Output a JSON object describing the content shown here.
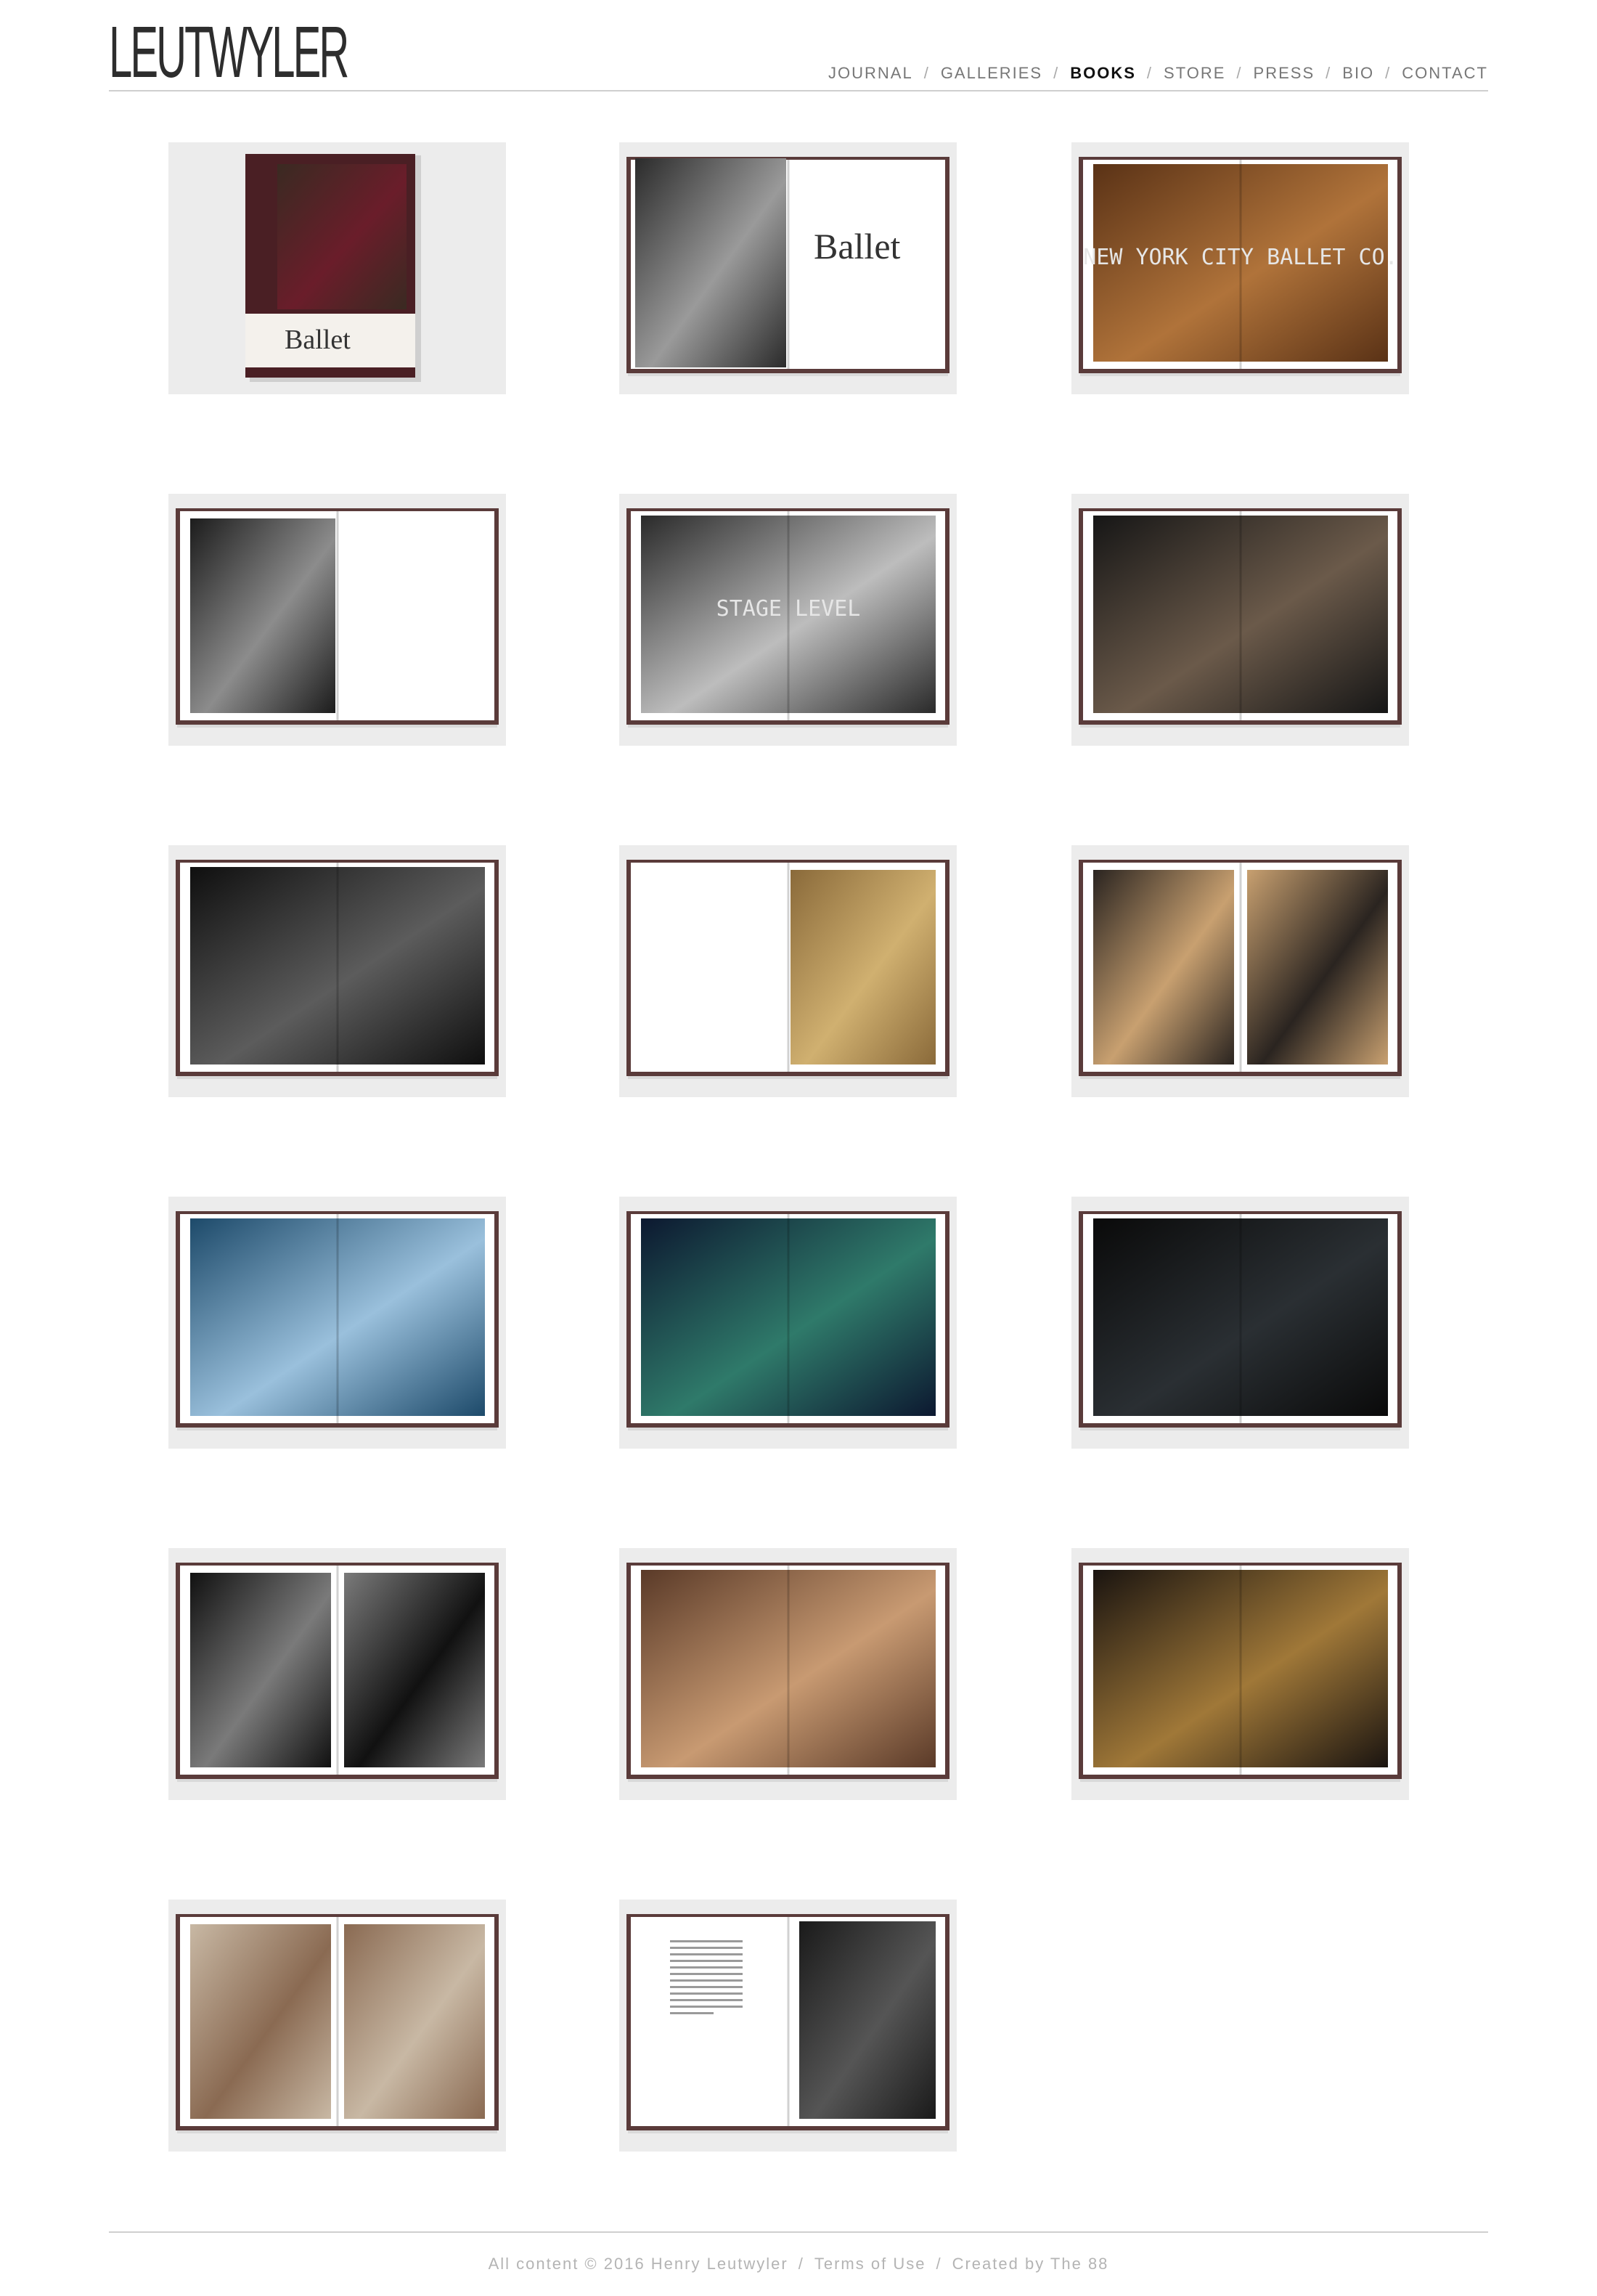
{
  "site": {
    "logo": "LEUTWYLER"
  },
  "nav": [
    {
      "label": "JOURNAL",
      "active": false
    },
    {
      "label": "GALLERIES",
      "active": false
    },
    {
      "label": "BOOKS",
      "active": true
    },
    {
      "label": "STORE",
      "active": false
    },
    {
      "label": "PRESS",
      "active": false
    },
    {
      "label": "BIO",
      "active": false
    },
    {
      "label": "CONTACT",
      "active": false
    }
  ],
  "nav_separator": "/",
  "gallery": {
    "items": [
      {
        "kind": "cover",
        "cover_title": "Ballet"
      },
      {
        "kind": "title-spread",
        "title": "Ballet"
      },
      {
        "kind": "full-spread",
        "text": "NEW YORK CITY BALLET CO."
      },
      {
        "kind": "left-photo-blank"
      },
      {
        "kind": "full-spread",
        "text": "STAGE LEVEL"
      },
      {
        "kind": "full-spread"
      },
      {
        "kind": "full-spread"
      },
      {
        "kind": "right-photo-blank"
      },
      {
        "kind": "two-photos"
      },
      {
        "kind": "full-spread"
      },
      {
        "kind": "full-spread"
      },
      {
        "kind": "full-spread"
      },
      {
        "kind": "two-photos"
      },
      {
        "kind": "full-spread"
      },
      {
        "kind": "full-spread"
      },
      {
        "kind": "two-photos"
      },
      {
        "kind": "text-photo"
      }
    ],
    "palette": [
      [
        "#3a2a22",
        "#6a1d2a"
      ],
      [
        "#2b2b2b",
        "#9a9a9a"
      ],
      [
        "#5a3216",
        "#b0733a"
      ],
      [
        "#1c1c1c",
        "#8c8c8c"
      ],
      [
        "#2a2a2a",
        "#bdbdbd"
      ],
      [
        "#161616",
        "#6b5a4a"
      ],
      [
        "#0f0f0f",
        "#5c5c5c"
      ],
      [
        "#8a6a3a",
        "#d0b070"
      ],
      [
        "#2a2420",
        "#c8a070"
      ],
      [
        "#1d4a6a",
        "#9ac0dc"
      ],
      [
        "#0c1830",
        "#2f7a6a"
      ],
      [
        "#0a0a0a",
        "#2a2f33"
      ],
      [
        "#111111",
        "#7a7a7a"
      ],
      [
        "#5a3a28",
        "#c89a72"
      ],
      [
        "#1a1410",
        "#a07838"
      ],
      [
        "#c8b8a4",
        "#8a6a52"
      ],
      [
        "#f2f2f2",
        "#1a1a1a"
      ]
    ]
  },
  "footer": {
    "copyright": "All content © 2016 Henry Leutwyler",
    "terms": "Terms of Use",
    "credit": "Created by The 88"
  }
}
